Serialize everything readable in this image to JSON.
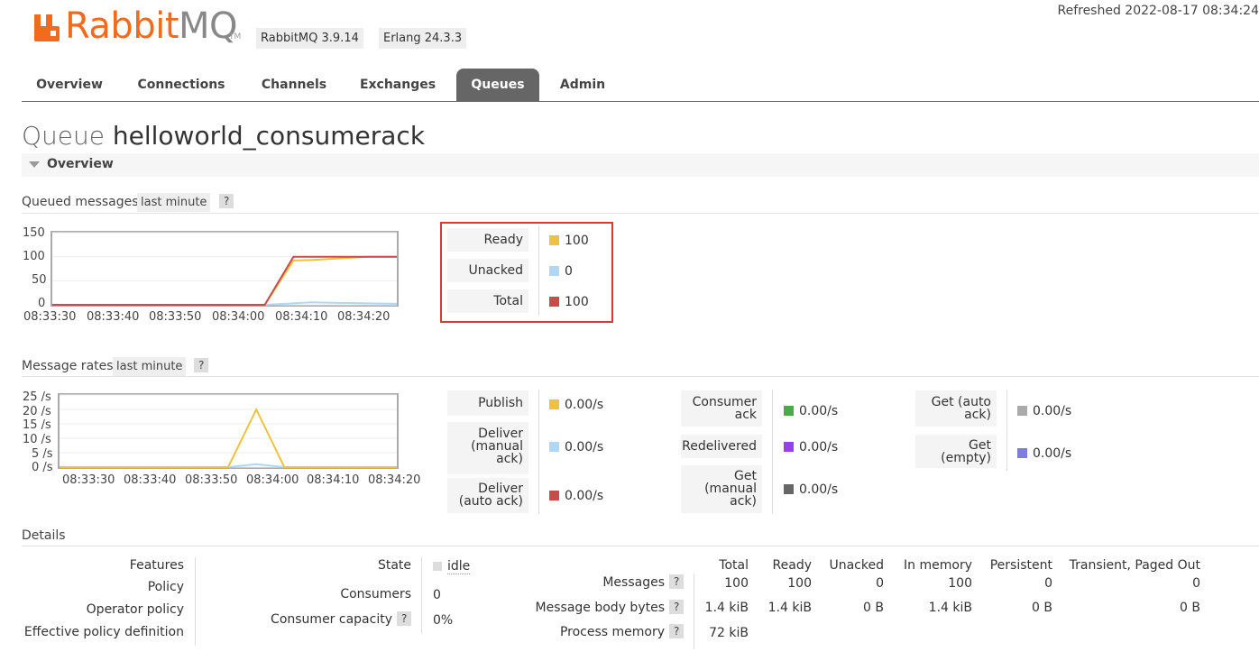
{
  "header": {
    "logo_rabbit": "Rabbit",
    "logo_mq": "MQ",
    "logo_tm": "TM",
    "version_tag": "RabbitMQ 3.9.14",
    "erlang_tag": "Erlang 24.3.3",
    "refreshed": "Refreshed 2022-08-17 08:34:24",
    "brand_color": "#f26b1d"
  },
  "nav": {
    "tabs": [
      {
        "label": "Overview"
      },
      {
        "label": "Connections"
      },
      {
        "label": "Channels"
      },
      {
        "label": "Exchanges"
      },
      {
        "label": "Queues",
        "active": true
      },
      {
        "label": "Admin"
      }
    ]
  },
  "page": {
    "title_prefix": "Queue",
    "queue_name": "helloworld_consumerack",
    "section": "Overview",
    "section_icon": "triangle-down-icon"
  },
  "queued": {
    "title": "Queued messages",
    "range": "last minute",
    "help": "?",
    "y_ticks": [
      "150",
      "100",
      "50",
      "0"
    ],
    "x_ticks": [
      "08:33:30",
      "08:33:40",
      "08:33:50",
      "08:34:00",
      "08:34:10",
      "08:34:20"
    ],
    "stats": [
      {
        "label": "Ready",
        "value": "100",
        "color": "#edc240"
      },
      {
        "label": "Unacked",
        "value": "0",
        "color": "#afd8f8"
      },
      {
        "label": "Total",
        "value": "100",
        "color": "#cb4b4b"
      }
    ]
  },
  "rates": {
    "title": "Message rates",
    "range": "last minute",
    "help": "?",
    "y_ticks": [
      "25 /s",
      "20 /s",
      "15 /s",
      "10 /s",
      "5 /s",
      "0 /s"
    ],
    "x_ticks": [
      "08:33:30",
      "08:33:40",
      "08:33:50",
      "08:34:00",
      "08:34:10",
      "08:34:20"
    ],
    "col1": [
      {
        "label": "Publish",
        "value": "0.00/s",
        "color": "#edc240"
      },
      {
        "label": "Deliver\n(manual\nack)",
        "value": "0.00/s",
        "color": "#afd8f8"
      },
      {
        "label": "Deliver\n(auto ack)",
        "value": "0.00/s",
        "color": "#cb4b4b"
      }
    ],
    "col2": [
      {
        "label": "Consumer\nack",
        "value": "0.00/s",
        "color": "#4da74d"
      },
      {
        "label": "Redelivered",
        "value": "0.00/s",
        "color": "#9440ed"
      },
      {
        "label": "Get\n(manual\nack)",
        "value": "0.00/s",
        "color": "#666666"
      }
    ],
    "col3": [
      {
        "label": "Get (auto\nack)",
        "value": "0.00/s",
        "color": "#aaaaaa"
      },
      {
        "label": "Get\n(empty)",
        "value": "0.00/s",
        "color": "#7e7ed8"
      }
    ]
  },
  "chart_data": [
    {
      "type": "line",
      "title": "Queued messages",
      "x": [
        "08:33:25",
        "08:33:30",
        "08:33:40",
        "08:33:50",
        "08:34:00",
        "08:34:02",
        "08:34:07",
        "08:34:10",
        "08:34:20",
        "08:34:25"
      ],
      "series": [
        {
          "name": "Ready",
          "values": [
            0,
            0,
            0,
            0,
            0,
            0,
            92,
            93,
            100,
            100
          ]
        },
        {
          "name": "Unacked",
          "values": [
            0,
            0,
            0,
            0,
            0,
            0,
            3,
            5,
            3,
            2
          ]
        },
        {
          "name": "Total",
          "values": [
            0,
            0,
            0,
            0,
            0,
            0,
            100,
            100,
            100,
            100
          ]
        }
      ],
      "ylim": [
        0,
        150
      ],
      "y_ticks": [
        0,
        50,
        100,
        150
      ]
    },
    {
      "type": "line",
      "title": "Message rates",
      "x": [
        "08:33:25",
        "08:33:30",
        "08:33:40",
        "08:33:50",
        "08:33:55",
        "08:34:00",
        "08:34:05",
        "08:34:10",
        "08:34:20",
        "08:34:25"
      ],
      "series": [
        {
          "name": "Publish",
          "values": [
            0,
            0,
            0,
            0,
            0,
            20,
            0,
            0,
            0,
            0
          ]
        },
        {
          "name": "Deliver (manual ack)",
          "values": [
            0,
            0,
            0,
            0,
            0,
            1,
            0,
            0,
            0,
            0
          ]
        }
      ],
      "ylim": [
        0,
        25
      ],
      "y_ticks": [
        0,
        5,
        10,
        15,
        20,
        25
      ]
    }
  ],
  "details": {
    "title": "Details",
    "left": [
      {
        "label": "Features",
        "value": ""
      },
      {
        "label": "Policy",
        "value": ""
      },
      {
        "label": "Operator policy",
        "value": ""
      },
      {
        "label": "Effective policy definition",
        "value": ""
      }
    ],
    "state_label": "State",
    "state_value": "idle",
    "consumers_label": "Consumers",
    "consumers_value": "0",
    "capacity_label": "Consumer capacity",
    "capacity_help": "?",
    "capacity_value": "0%",
    "table_headers": [
      "Total",
      "Ready",
      "Unacked",
      "In memory",
      "Persistent",
      "Transient, Paged Out"
    ],
    "rows": [
      {
        "label": "Messages",
        "help": "?",
        "values": [
          "100",
          "100",
          "0",
          "100",
          "0",
          "0"
        ]
      },
      {
        "label": "Message body bytes",
        "help": "?",
        "values": [
          "1.4 kiB",
          "1.4 kiB",
          "0 B",
          "1.4 kiB",
          "0 B",
          "0 B"
        ]
      },
      {
        "label": "Process memory",
        "help": "?",
        "values": [
          "72 kiB",
          "",
          "",
          "",
          "",
          ""
        ]
      }
    ]
  }
}
